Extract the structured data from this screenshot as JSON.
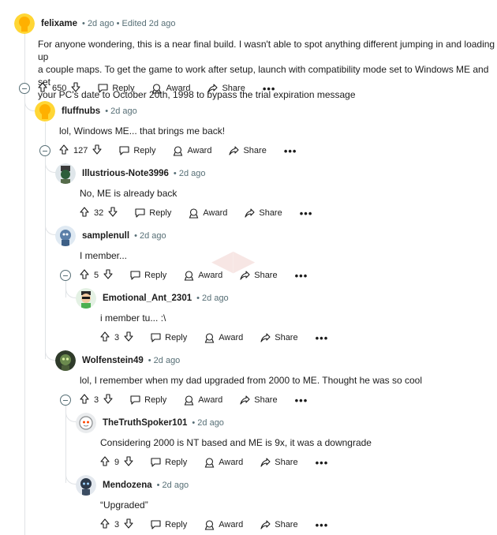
{
  "labels": {
    "reply": "Reply",
    "award": "Award",
    "share": "Share",
    "more": "•••"
  },
  "comments": [
    {
      "author": "felixame",
      "meta": "• 2d ago • Edited 2d ago",
      "lines": [
        "For anyone wondering, this is a near final build. I wasn't able to spot anything different jumping in and loading up",
        "a couple maps. To get the game to work after setup, launch with compatibility mode set to Windows ME and set",
        "your PC's date to October 20th, 1998 to bypass the trial expiration message"
      ],
      "votes": "650"
    },
    {
      "author": "fluffnubs",
      "meta": "• 2d ago",
      "lines": [
        "lol, Windows ME... that brings me back!"
      ],
      "votes": "127"
    },
    {
      "author": "Illustrious-Note3996",
      "meta": "• 2d ago",
      "lines": [
        "No, ME is already back"
      ],
      "votes": "32"
    },
    {
      "author": "samplenull",
      "meta": "• 2d ago",
      "lines": [
        "I member..."
      ],
      "votes": "5"
    },
    {
      "author": "Emotional_Ant_2301",
      "meta": "• 2d ago",
      "lines": [
        "i member tu... :\\"
      ],
      "votes": "3"
    },
    {
      "author": "Wolfenstein49",
      "meta": "• 2d ago",
      "lines": [
        "lol, I remember when my dad upgraded from 2000 to ME. Thought he was so cool"
      ],
      "votes": "3"
    },
    {
      "author": "TheTruthSpoker101",
      "meta": "• 2d ago",
      "lines": [
        "Considering 2000 is NT based and ME is 9x, it was a downgrade"
      ],
      "votes": "9"
    },
    {
      "author": "Mendozena",
      "meta": "• 2d ago",
      "lines": [
        "“Upgraded”"
      ],
      "votes": "3"
    }
  ],
  "colors": {
    "text": "#1c1c1c",
    "meta": "#576f76",
    "line": "#e0e3e6"
  }
}
